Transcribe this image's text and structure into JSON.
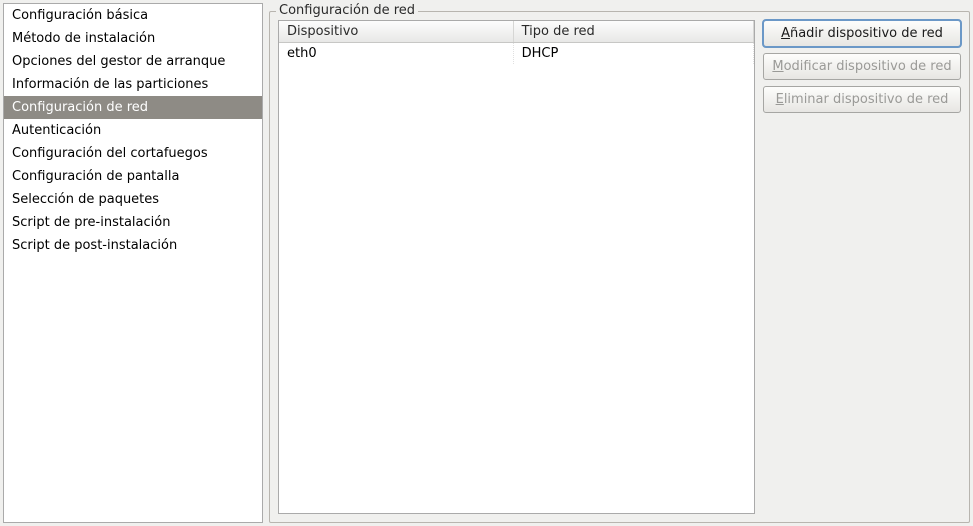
{
  "sidebar": {
    "items": [
      {
        "label": "Configuración básica"
      },
      {
        "label": "Método de instalación"
      },
      {
        "label": "Opciones del gestor de arranque"
      },
      {
        "label": "Información de las particiones"
      },
      {
        "label": "Configuración de red"
      },
      {
        "label": "Autenticación"
      },
      {
        "label": "Configuración del cortafuegos"
      },
      {
        "label": "Configuración de pantalla"
      },
      {
        "label": "Selección de paquetes"
      },
      {
        "label": "Script de pre-instalación"
      },
      {
        "label": "Script de post-instalación"
      }
    ],
    "selected_index": 4
  },
  "panel": {
    "title": "Configuración de red",
    "table": {
      "columns": [
        "Dispositivo",
        "Tipo de red"
      ],
      "rows": [
        {
          "device": "eth0",
          "type": "DHCP"
        }
      ]
    },
    "buttons": {
      "add": {
        "mnemonic": "A",
        "rest": "ñadir dispositivo de red",
        "enabled": true,
        "focused": true
      },
      "modify": {
        "mnemonic": "M",
        "rest": "odificar dispositivo de red",
        "enabled": false,
        "focused": false
      },
      "delete": {
        "mnemonic": "E",
        "rest": "liminar dispositivo de red",
        "enabled": false,
        "focused": false
      }
    }
  }
}
